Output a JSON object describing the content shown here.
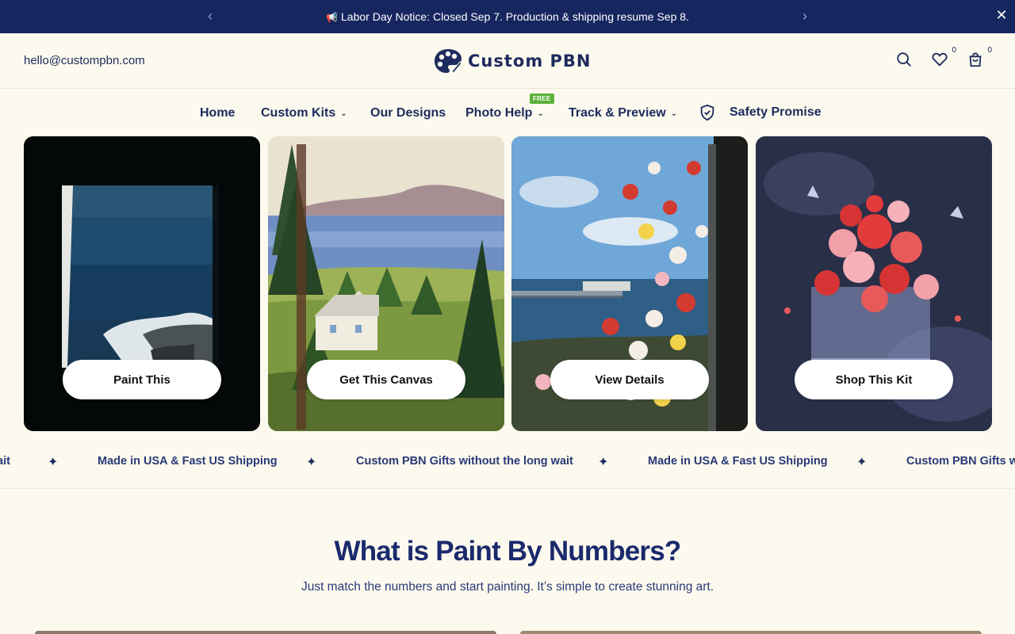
{
  "announcement": {
    "icon": "megaphone-icon",
    "text": "Labor Day Notice: Closed Sep 7. Production & shipping resume Sep 8.",
    "prev_icon": "chevron-left-icon",
    "next_icon": "chevron-right-icon",
    "close_icon": "close-icon"
  },
  "header": {
    "email": "hello@custompbn.com",
    "logo_text": "Custom PBN",
    "wishlist_count": "0",
    "cart_count": "0"
  },
  "nav": {
    "items": [
      {
        "label": "Home"
      },
      {
        "label": "Custom Kits",
        "dropdown": true
      },
      {
        "label": "Our Designs"
      },
      {
        "label": "Photo Help",
        "dropdown": true,
        "badge": "FREE"
      },
      {
        "label": "Track & Preview",
        "dropdown": true
      },
      {
        "label": "Safety Promise",
        "icon": "shield-check-icon"
      }
    ]
  },
  "cards": [
    {
      "cta": "Paint This"
    },
    {
      "cta": "Get This Canvas"
    },
    {
      "cta": "View Details"
    },
    {
      "cta": "Shop This Kit"
    }
  ],
  "marquee": {
    "items": [
      "Made in USA & Fast US Shipping",
      "Custom PBN Gifts without the long wait"
    ],
    "partial_start": "ait",
    "partial_end": "Custom PBN Gifts wit",
    "separator_icon": "sparkle-icon"
  },
  "intro": {
    "title": "What is Paint By Numbers?",
    "subtitle": "Just match the numbers and start painting. It’s simple to create stunning art."
  },
  "colors": {
    "announcement_bg": "#16265f",
    "page_bg": "#fcf9ee",
    "brand_navy": "#1d2b5e",
    "badge_green": "#5cb23b"
  }
}
